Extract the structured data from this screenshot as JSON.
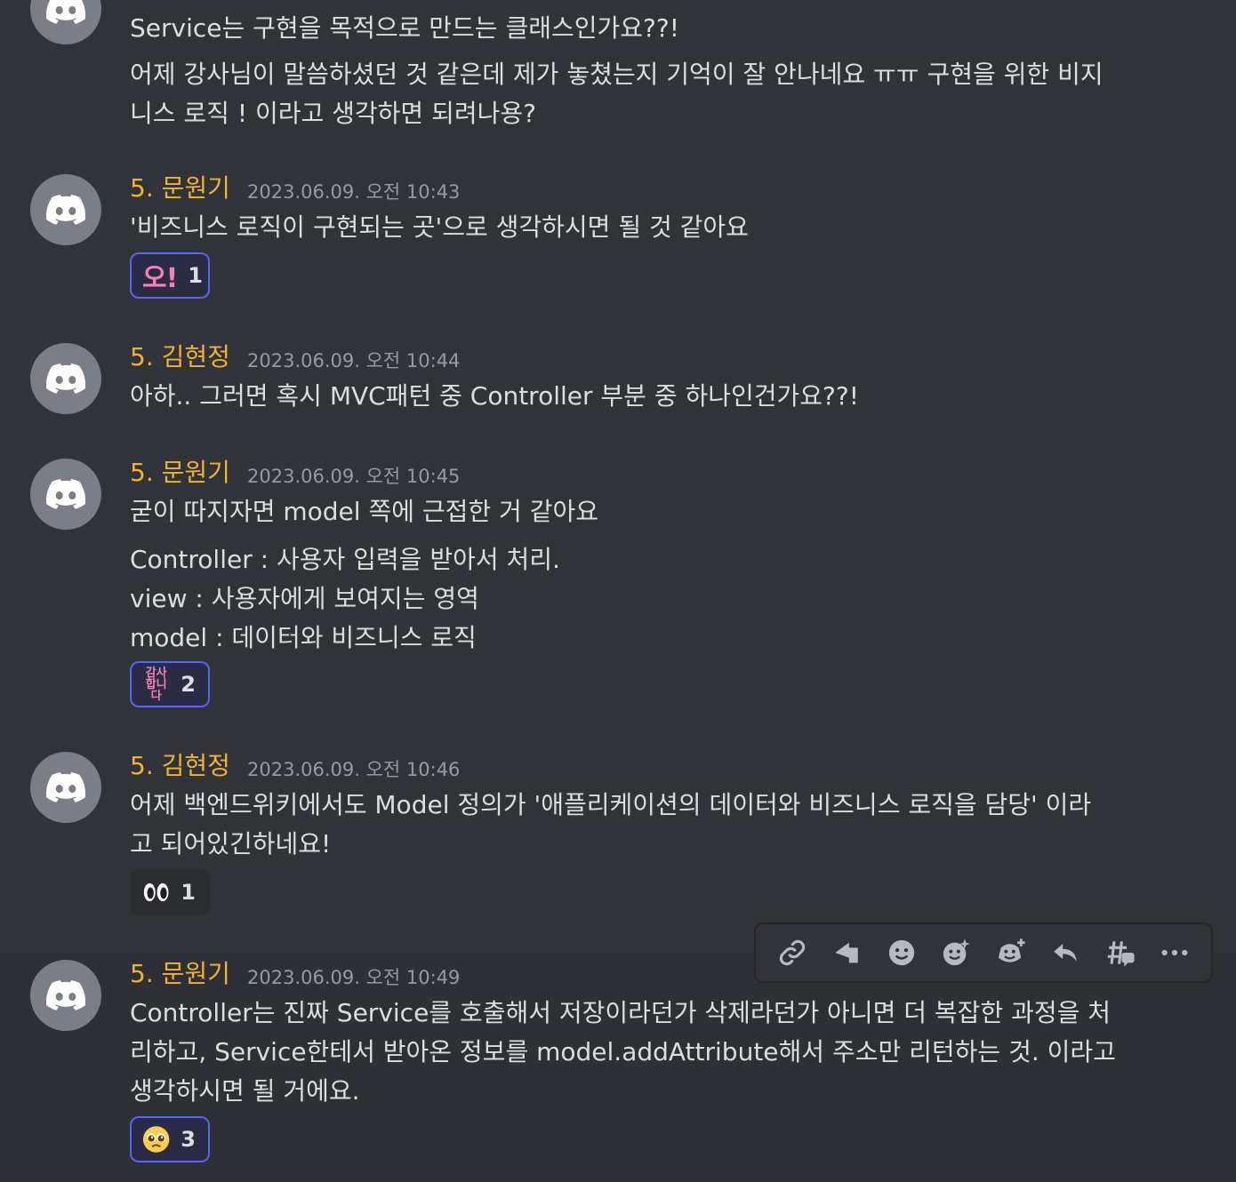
{
  "messages": [
    {
      "username": "",
      "timestamp": "",
      "lines": [
        "Service는 구현을 목적으로 만드는 클래스인가요??!",
        "어제 강사님이 말씀하셨던 것 같은데 제가 놓쳤는지 기억이 잘 안나네요 ㅠㅠ 구현을 위한 비지",
        "니스 로직 ! 이라고 생각하면 되려나용?"
      ]
    },
    {
      "username": "5. 문원기",
      "timestamp": "2023.06.09. 오전 10:43",
      "lines": [
        "'비즈니스 로직이 구현되는 곳'으로 생각하시면 될 것 같아요"
      ],
      "reaction": {
        "emoji": "오!",
        "count": "1",
        "icon": "oh-emoji"
      }
    },
    {
      "username": "5. 김현정",
      "timestamp": "2023.06.09. 오전 10:44",
      "lines": [
        "아하.. 그러면 혹시 MVC패턴 중 Controller 부분 중 하나인건가요??!"
      ]
    },
    {
      "username": "5. 문원기",
      "timestamp": "2023.06.09. 오전 10:45",
      "lines": [
        "굳이 따지자면 model 쪽에 근접한 거 같아요",
        "Controller : 사용자 입력을 받아서 처리.",
        "view : 사용자에게 보여지는 영역",
        "model : 데이터와 비즈니스 로직"
      ],
      "reaction": {
        "emoji_top": "감사",
        "emoji_bottom": "합니다",
        "count": "2",
        "icon": "thanks-emoji"
      }
    },
    {
      "username": "5. 김현정",
      "timestamp": "2023.06.09. 오전 10:46",
      "lines": [
        "어제 백엔드위키에서도 Model 정의가 '애플리케이션의 데이터와 비즈니스 로직을 담당' 이라",
        "고 되어있긴하네요!"
      ],
      "reaction": {
        "count": "1",
        "icon": "eyes-emoji"
      }
    },
    {
      "username": "5. 문원기",
      "timestamp": "2023.06.09. 오전 10:49",
      "lines": [
        "Controller는 진짜 Service를 호출해서 저장이라던가 삭제라던가 아니면 더 복잡한 과정을 처",
        "리하고, Service한테서 받아온 정보를 model.addAttribute해서 주소만 리턴하는 것. 이라고",
        "생각하시면 될 거에요."
      ],
      "reaction": {
        "count": "3",
        "icon": "pleading-face-emoji"
      }
    }
  ],
  "toolbar": {
    "icons": [
      "link-icon",
      "send-icon",
      "add-reaction-icon",
      "super-reaction-icon",
      "add-more-reaction-icon",
      "reply-icon",
      "create-thread-icon",
      "more-icon"
    ]
  },
  "colors": {
    "background": "#313338",
    "username": "#f0b232",
    "timestamp": "#949ba4",
    "text": "#dbdee1",
    "reaction_border": "#5865f2",
    "avatar": "#7a7e87"
  }
}
